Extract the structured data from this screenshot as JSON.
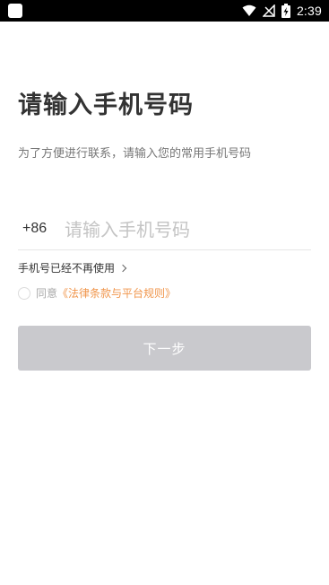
{
  "status_bar": {
    "time": "2:39",
    "icons": [
      "app-notification-icon",
      "wifi-icon",
      "no-signal-icon",
      "battery-charging-icon"
    ]
  },
  "colors": {
    "status_bar_bg": "#000000",
    "title_text": "#333333",
    "subtitle_text": "#777777",
    "placeholder_text": "#c4c4c4",
    "link_orange": "#f0964c",
    "button_disabled_bg": "#c9c9cd",
    "button_text": "#ffffff"
  },
  "header": {
    "title": "请输入手机号码",
    "subtitle": "为了方便进行联系，请输入您的常用手机号码"
  },
  "phone": {
    "country_code": "+86",
    "value": "",
    "placeholder": "请输入手机号码"
  },
  "links": {
    "no_longer_used": "手机号已经不再使用"
  },
  "agreement": {
    "checked": false,
    "prefix": "同意",
    "terms": "《法律条款与平台规则》"
  },
  "actions": {
    "next_label": "下一步",
    "next_enabled": false
  }
}
